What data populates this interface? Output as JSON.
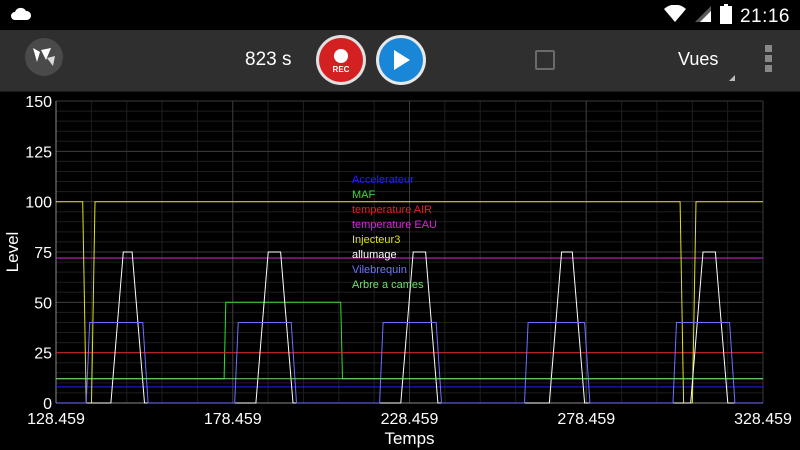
{
  "status_bar": {
    "time": "21:16",
    "icons": [
      "cloud-icon",
      "wifi-icon",
      "signal-icon",
      "battery-icon"
    ]
  },
  "toolbar": {
    "timer": "823 s",
    "rec_label": "REC",
    "views_label": "Vues",
    "checkbox_checked": false
  },
  "colors": {
    "background": "#000000",
    "actionbar": "#2f2f2f",
    "rec": "#d32020",
    "play": "#1a86d8",
    "grid": "#3a3a3a"
  },
  "chart_data": {
    "type": "line",
    "xlabel": "Temps",
    "ylabel": "Level",
    "xlim": [
      128.459,
      328.459
    ],
    "ylim": [
      0,
      150
    ],
    "x_ticks": [
      "128.459",
      "178.459",
      "228.459",
      "278.459",
      "328.459"
    ],
    "y_ticks": [
      "0",
      "25",
      "50",
      "75",
      "100",
      "125",
      "150"
    ],
    "grid": true,
    "legend_placement": "center",
    "series": [
      {
        "name": "Accelerateur",
        "color": "#2020ff",
        "points": [
          [
            128.459,
            8
          ],
          [
            328.459,
            8
          ]
        ]
      },
      {
        "name": "MAF",
        "color": "#30e030",
        "points": [
          [
            128.459,
            12
          ],
          [
            176,
            12
          ],
          [
            176.5,
            50
          ],
          [
            209,
            50
          ],
          [
            209.5,
            12
          ],
          [
            328.459,
            12
          ]
        ]
      },
      {
        "name": "temperature AIR",
        "color": "#e02020",
        "points": [
          [
            128.459,
            25
          ],
          [
            328.459,
            25
          ]
        ]
      },
      {
        "name": "temperature EAU",
        "color": "#e020e0",
        "points": [
          [
            128.459,
            72
          ],
          [
            328.459,
            72
          ]
        ]
      },
      {
        "name": "Injecteur3",
        "color": "#e0e020",
        "points": [
          [
            128.459,
            100
          ],
          [
            136,
            100
          ],
          [
            137,
            0
          ],
          [
            138.5,
            0
          ],
          [
            139.5,
            100
          ],
          [
            305,
            100
          ],
          [
            306,
            0
          ],
          [
            308.5,
            0
          ],
          [
            309.5,
            100
          ],
          [
            328.459,
            100
          ]
        ]
      },
      {
        "name": "allumage",
        "color": "#ffffff",
        "points": [
          [
            128.459,
            0
          ],
          [
            144,
            0
          ],
          [
            147.5,
            75
          ],
          [
            150,
            75
          ],
          [
            153.5,
            0
          ],
          [
            185,
            0
          ],
          [
            188.5,
            75
          ],
          [
            192,
            75
          ],
          [
            195.5,
            0
          ],
          [
            226,
            0
          ],
          [
            229.5,
            75
          ],
          [
            233,
            75
          ],
          [
            236.5,
            0
          ],
          [
            268,
            0
          ],
          [
            271.5,
            75
          ],
          [
            274.5,
            75
          ],
          [
            278,
            0
          ],
          [
            308,
            0
          ],
          [
            311.5,
            75
          ],
          [
            315,
            75
          ],
          [
            318.5,
            0
          ],
          [
            328.459,
            0
          ]
        ]
      },
      {
        "name": "Vilebrequin",
        "color": "#7070ff",
        "points": [
          [
            128.459,
            0
          ],
          [
            137,
            0
          ],
          [
            138,
            40
          ],
          [
            153,
            40
          ],
          [
            154.5,
            0
          ],
          [
            179,
            0
          ],
          [
            180,
            40
          ],
          [
            195,
            40
          ],
          [
            196.5,
            0
          ],
          [
            220,
            0
          ],
          [
            221,
            40
          ],
          [
            236,
            40
          ],
          [
            237.5,
            0
          ],
          [
            261,
            0
          ],
          [
            262,
            40
          ],
          [
            278,
            40
          ],
          [
            279.5,
            0
          ],
          [
            303,
            0
          ],
          [
            304,
            40
          ],
          [
            319,
            40
          ],
          [
            320.5,
            0
          ],
          [
            328.459,
            0
          ]
        ]
      },
      {
        "name": "Arbre a cames",
        "color": "#70e070",
        "points": [
          [
            128.459,
            12
          ],
          [
            328.459,
            12
          ]
        ]
      }
    ]
  }
}
